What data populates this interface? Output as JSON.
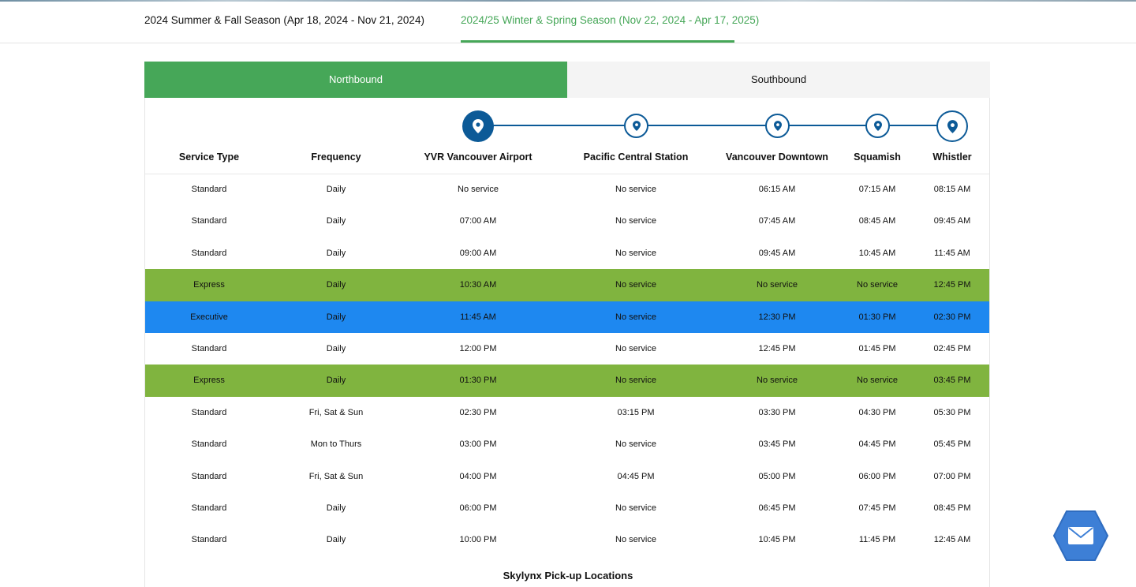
{
  "seasons": {
    "tab1": "2024 Summer & Fall Season (Apr 18, 2024 - Nov 21, 2024)",
    "tab2": "2024/25 Winter & Spring Season (Nov 22, 2024 - Apr 17, 2025)",
    "active": "tab2"
  },
  "directions": {
    "north": "Northbound",
    "south": "Southbound",
    "active": "north"
  },
  "columns": [
    "Service Type",
    "Frequency",
    "YVR Vancouver Airport",
    "Pacific Central Station",
    "Vancouver Downtown",
    "Squamish",
    "Whistler"
  ],
  "stops_icon": "map-pin-icon",
  "rows": [
    {
      "type": "Standard",
      "freq": "Daily",
      "yvr": "No service",
      "pcs": "No service",
      "dt": "06:15 AM",
      "sq": "07:15 AM",
      "wh": "08:15 AM"
    },
    {
      "type": "Standard",
      "freq": "Daily",
      "yvr": "07:00 AM",
      "pcs": "No service",
      "dt": "07:45 AM",
      "sq": "08:45 AM",
      "wh": "09:45 AM"
    },
    {
      "type": "Standard",
      "freq": "Daily",
      "yvr": "09:00 AM",
      "pcs": "No service",
      "dt": "09:45 AM",
      "sq": "10:45 AM",
      "wh": "11:45 AM"
    },
    {
      "type": "Express",
      "freq": "Daily",
      "yvr": "10:30 AM",
      "pcs": "No service",
      "dt": "No service",
      "sq": "No service",
      "wh": "12:45 PM"
    },
    {
      "type": "Executive",
      "freq": "Daily",
      "yvr": "11:45 AM",
      "pcs": "No service",
      "dt": "12:30 PM",
      "sq": "01:30 PM",
      "wh": "02:30 PM"
    },
    {
      "type": "Standard",
      "freq": "Daily",
      "yvr": "12:00 PM",
      "pcs": "No service",
      "dt": "12:45 PM",
      "sq": "01:45 PM",
      "wh": "02:45 PM"
    },
    {
      "type": "Express",
      "freq": "Daily",
      "yvr": "01:30 PM",
      "pcs": "No service",
      "dt": "No service",
      "sq": "No service",
      "wh": "03:45 PM"
    },
    {
      "type": "Standard",
      "freq": "Fri, Sat & Sun",
      "yvr": "02:30 PM",
      "pcs": "03:15 PM",
      "dt": "03:30 PM",
      "sq": "04:30 PM",
      "wh": "05:30 PM"
    },
    {
      "type": "Standard",
      "freq": "Mon to Thurs",
      "yvr": "03:00 PM",
      "pcs": "No service",
      "dt": "03:45 PM",
      "sq": "04:45 PM",
      "wh": "05:45 PM"
    },
    {
      "type": "Standard",
      "freq": "Fri, Sat & Sun",
      "yvr": "04:00 PM",
      "pcs": "04:45 PM",
      "dt": "05:00 PM",
      "sq": "06:00 PM",
      "wh": "07:00 PM"
    },
    {
      "type": "Standard",
      "freq": "Daily",
      "yvr": "06:00 PM",
      "pcs": "No service",
      "dt": "06:45 PM",
      "sq": "07:45 PM",
      "wh": "08:45 PM"
    },
    {
      "type": "Standard",
      "freq": "Daily",
      "yvr": "10:00 PM",
      "pcs": "No service",
      "dt": "10:45 PM",
      "sq": "11:45 PM",
      "wh": "12:45 AM"
    }
  ],
  "pickup_title": "Skylynx Pick-up Locations",
  "chat_icon": "envelope-icon",
  "colors": {
    "accent_green": "#46a758",
    "express_row": "#80b43f",
    "executive_row": "#1e88f0",
    "route_blue": "#0c5a97"
  }
}
